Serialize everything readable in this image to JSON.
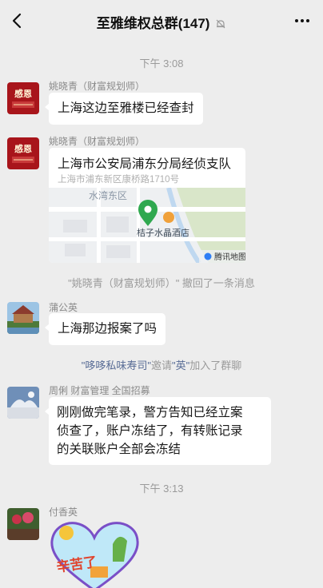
{
  "header": {
    "title": "至雅维权总群(147)"
  },
  "times": [
    "下午 3:08",
    "下午 3:13"
  ],
  "messages": [
    {
      "sender": "姚晓青（财富规划师）",
      "text": "上海这边至雅楼已经查封"
    },
    {
      "sender": "姚晓青（财富规划师）",
      "location": {
        "title": "上海市公安局浦东分局经侦支队",
        "address": "上海市浦东新区康桥路1710号",
        "map_labels": {
          "district": "水湾东区",
          "hotel": "桔子水晶酒店",
          "provider": "腾讯地图"
        }
      }
    },
    {
      "sender": "蒲公英",
      "text": "上海那边报案了吗"
    },
    {
      "sender": "周俐  财富管理  全国招募",
      "text_lines": [
        "刚刚做完笔录，警方告知已经立案",
        "侦查了，账户冻结了，有转账记录",
        "的关联账户全部会冻结"
      ]
    },
    {
      "sender": "付香英",
      "sticker_text": "辛苦了"
    }
  ],
  "system": {
    "recall": "\"姚晓青（财富规划师）\" 撤回了一条消息",
    "join": {
      "inviter": "\"哆哆私味寿司\"",
      "mid": "邀请",
      "invitee": "\"英\"",
      "end": "加入了群聊"
    }
  },
  "colors": {
    "background": "#ededed",
    "bubble": "#ffffff",
    "link": "#576b95",
    "muted": "#9a9a9a"
  }
}
